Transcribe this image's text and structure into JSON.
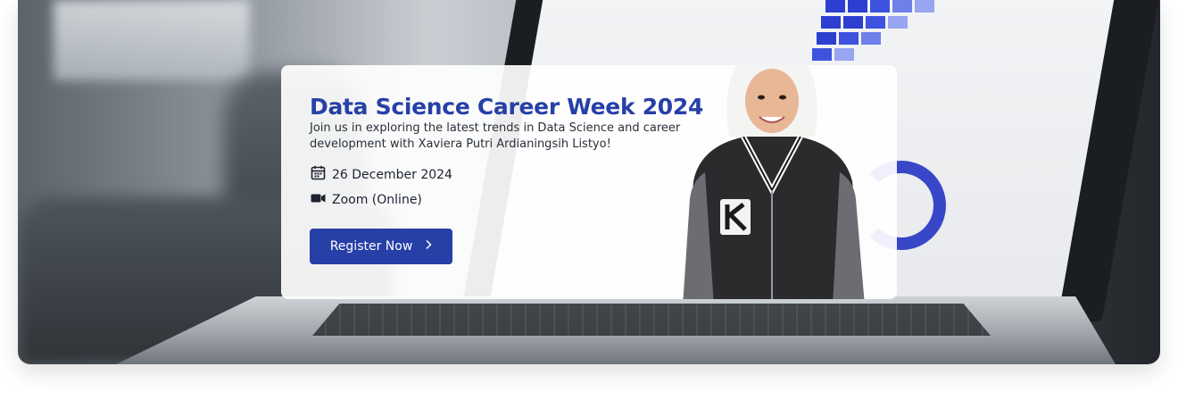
{
  "event": {
    "title": "Data Science Career Week 2024",
    "description": "Join us in exploring the latest trends in Data Science and career development with Xaviera Putri Ardianingsih Listyo!",
    "date": "26 December 2024",
    "location": "Zoom (Online)",
    "register_label": "Register Now"
  },
  "icons": {
    "date": "calendar-icon",
    "location": "video-camera-icon",
    "register": "chevron-right-icon"
  },
  "colors": {
    "brand": "#2740a7",
    "button_text": "#ffffff"
  }
}
